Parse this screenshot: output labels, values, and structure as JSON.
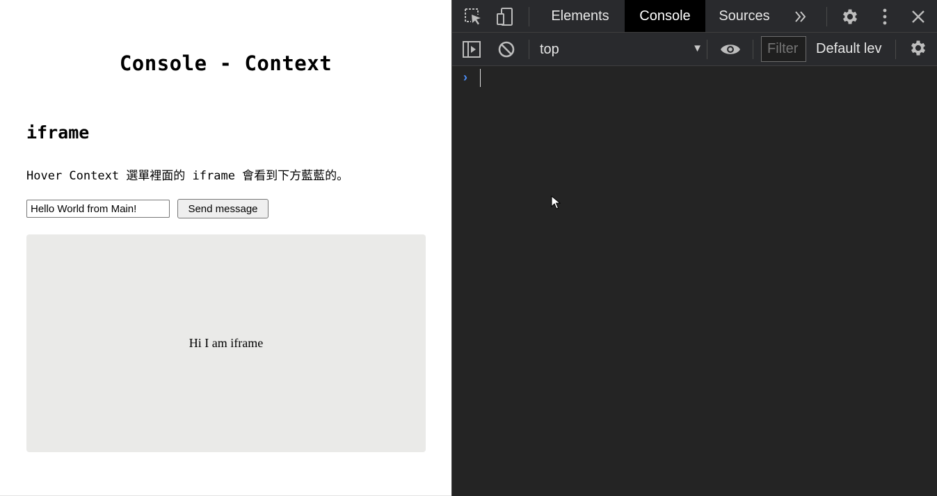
{
  "page": {
    "title": "Console - Context",
    "section_title": "iframe",
    "description": "Hover Context 選單裡面的 iframe 會看到下方藍藍的。",
    "message_input_value": "Hello World from Main!",
    "send_button_label": "Send message",
    "iframe_text": "Hi I am iframe"
  },
  "devtools": {
    "tabs": [
      {
        "label": "Elements"
      },
      {
        "label": "Console",
        "active": true
      },
      {
        "label": "Sources"
      }
    ],
    "toolbar": {
      "context": "top",
      "filter_placeholder": "Filter",
      "levels_label": "Default lev"
    },
    "icons": [
      "inspect-icon",
      "device-toggle-icon",
      "more-tabs-icon",
      "settings-icon",
      "kebab-menu-icon",
      "close-icon",
      "sidebar-toggle-icon",
      "clear-console-icon",
      "eye-icon",
      "console-settings-icon",
      "prompt-chevron-icon"
    ],
    "colors": {
      "panel_bg": "#242424",
      "toolbar_bg": "#292a2d",
      "active_tab_bg": "#000000",
      "prompt_accent": "#4d8ef8",
      "iframe_bg": "#eaeae8"
    }
  }
}
